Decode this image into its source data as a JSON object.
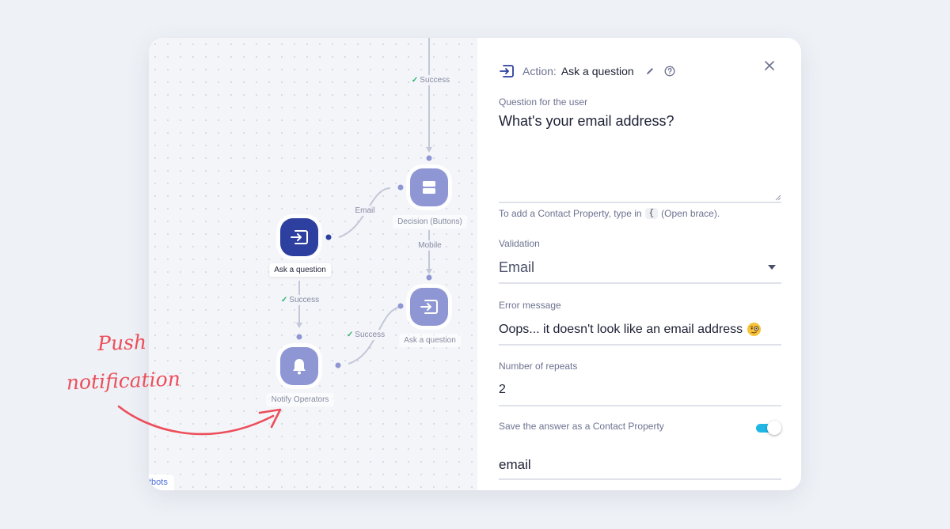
{
  "canvas": {
    "nodes": {
      "ask_main": "Ask a question",
      "decision": "Decision (Buttons)",
      "ask_second": "Ask a question",
      "notify": "Notify Operators"
    },
    "edges": {
      "top_success": "Success",
      "email": "Email",
      "mobile": "Mobile",
      "ask_success": "Success",
      "notify_success": "Success"
    },
    "bottom_chip": "tbots"
  },
  "panel": {
    "action_label": "Action:",
    "action_name": "Ask a question",
    "question_label": "Question for the user",
    "question_value": "What's your email address?",
    "hint_before": "To add a Contact Property, type in",
    "hint_key": "{",
    "hint_after": "(Open brace).",
    "validation_label": "Validation",
    "validation_value": "Email",
    "error_label": "Error message",
    "error_value": "Oops... it doesn't look like an email address",
    "repeats_label": "Number of repeats",
    "repeats_value": "2",
    "save_label": "Save the answer as a Contact Property",
    "save_enabled": true,
    "property_value": "email"
  },
  "annotation": {
    "line1": "Push",
    "line2": "notification"
  },
  "colors": {
    "accent": "#2d3f9f",
    "node_light": "#8e97d4",
    "success": "#2fb36b",
    "toggle": "#1fb6e6",
    "annotation": "#ec4e5a"
  }
}
